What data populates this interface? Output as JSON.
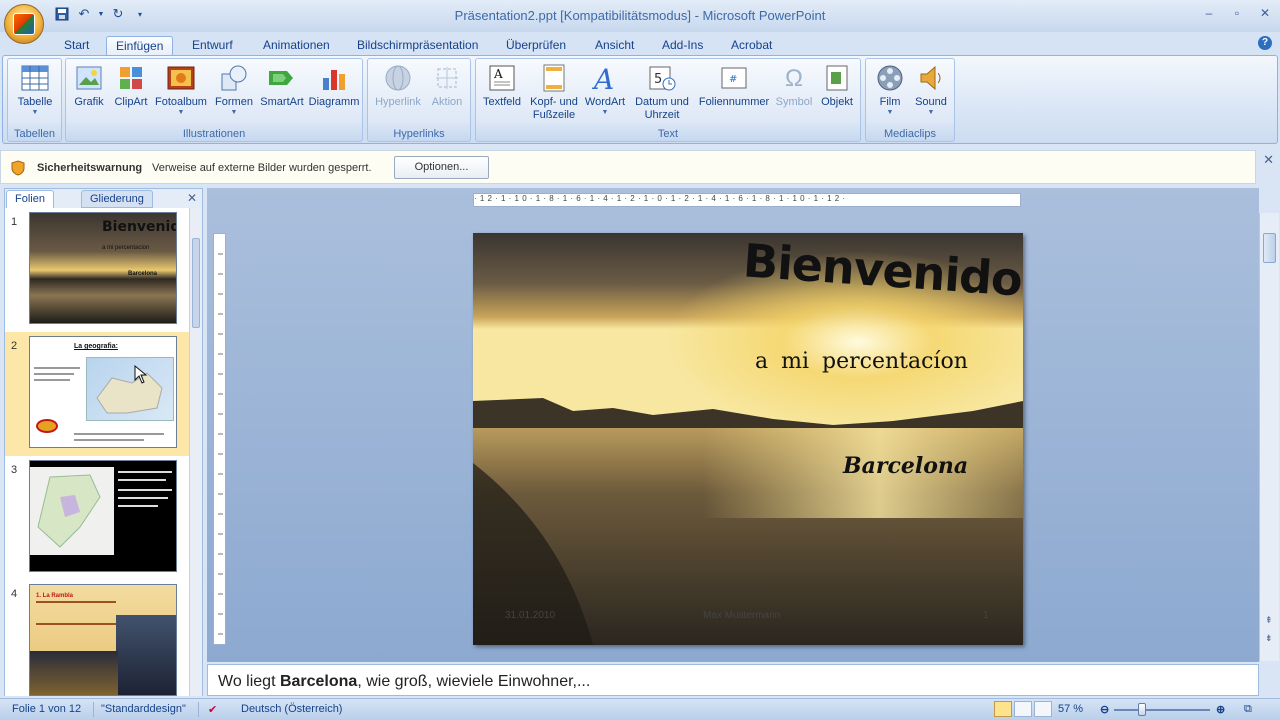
{
  "window": {
    "title": "Präsentation2.ppt [Kompatibilitätsmodus] - Microsoft PowerPoint"
  },
  "tabs": [
    "Start",
    "Einfügen",
    "Entwurf",
    "Animationen",
    "Bildschirmpräsentation",
    "Überprüfen",
    "Ansicht",
    "Add-Ins",
    "Acrobat"
  ],
  "active_tab": "Einfügen",
  "ribbon": {
    "groups": {
      "tabellen": "Tabellen",
      "illustrationen": "Illustrationen",
      "hyperlinks": "Hyperlinks",
      "text": "Text",
      "mediaclips": "Mediaclips"
    },
    "buttons": {
      "tabelle": "Tabelle",
      "grafik": "Grafik",
      "clipart": "ClipArt",
      "fotoalbum": "Fotoalbum",
      "formen": "Formen",
      "smartart": "SmartArt",
      "diagramm": "Diagramm",
      "hyperlink": "Hyperlink",
      "aktion": "Aktion",
      "textfeld": "Textfeld",
      "kopf1": "Kopf- und",
      "kopf2": "Fußzeile",
      "wordart": "WordArt",
      "datum1": "Datum und",
      "datum2": "Uhrzeit",
      "foliennummer": "Foliennummer",
      "symbol": "Symbol",
      "objekt": "Objekt",
      "film": "Film",
      "sound": "Sound"
    }
  },
  "security_bar": {
    "title": "Sicherheitswarnung",
    "message": "Verweise auf externe Bilder wurden gesperrt.",
    "button": "Optionen..."
  },
  "left_pane": {
    "tab_slides": "Folien",
    "tab_outline": "Gliederung",
    "slides": [
      {
        "num": "1",
        "title": "Bienvenido",
        "sub": "a mi percentacion",
        "city": "Barcelona"
      },
      {
        "num": "2",
        "title": "La geografia:"
      },
      {
        "num": "3"
      },
      {
        "num": "4",
        "title": "1. La Rambla"
      }
    ]
  },
  "slide": {
    "title": "Bienvenido",
    "subtitle": "a mi percentacíon",
    "city": "Barcelona",
    "date": "31.01.2010",
    "author": "Max Mustermann",
    "number": "1"
  },
  "ruler_ticks": "·12·1·10·1·8·1·6·1·4·1·2·1·0·1·2·1·4·1·6·1·8·1·10·1·12·",
  "notes": {
    "prefix": "Wo liegt ",
    "bold": "Barcelona",
    "suffix": ", wie groß, wieviele Einwohner,..."
  },
  "status": {
    "slide_info": "Folie 1 von 12",
    "design": "\"Standarddesign\"",
    "language": "Deutsch (Österreich)",
    "zoom": "57 %",
    "zoom_fraction": 0.57
  }
}
